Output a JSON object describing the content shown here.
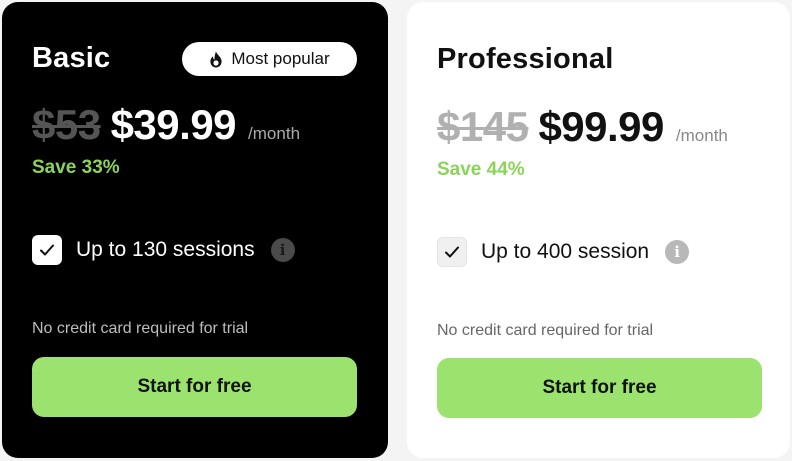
{
  "colors": {
    "accent_green": "#9be36e",
    "save_green": "#8bd45a",
    "basic_card_bg": "#000000",
    "pro_card_bg": "#ffffff"
  },
  "plans": [
    {
      "name": "Basic",
      "badge": {
        "icon": "flame-icon",
        "label": "Most popular"
      },
      "old_price": "$53",
      "price": "$39.99",
      "period": "/month",
      "save": "Save 33%",
      "feature": {
        "icon": "checkmark-icon",
        "label": "Up to 130 sessions",
        "info_icon": "info-icon"
      },
      "note": "No credit card required for trial",
      "cta": "Start for free"
    },
    {
      "name": "Professional",
      "old_price": "$145",
      "price": "$99.99",
      "period": "/month",
      "save": "Save 44%",
      "feature": {
        "icon": "checkmark-icon",
        "label": "Up to 400 session",
        "info_icon": "info-icon"
      },
      "note": "No credit card required for trial",
      "cta": "Start for free"
    }
  ]
}
